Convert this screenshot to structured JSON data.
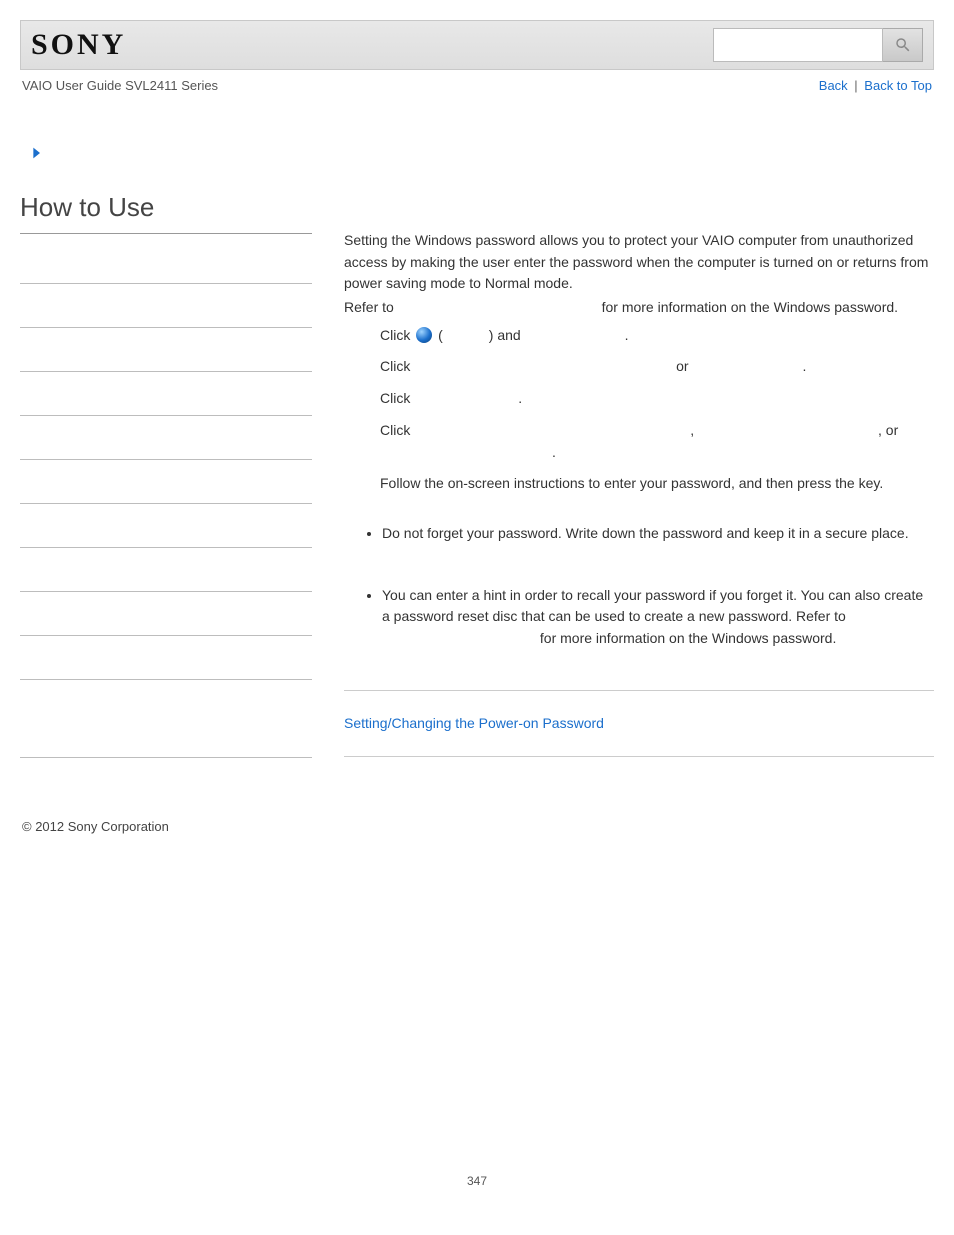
{
  "header": {
    "logo_text": "SONY",
    "search_placeholder": ""
  },
  "subheader": {
    "guide_title": "VAIO User Guide SVL2411 Series",
    "nav": {
      "back": "Back",
      "top": "Back to Top",
      "sep": " | "
    }
  },
  "sidebar": {
    "heading": "How to Use"
  },
  "main": {
    "intro1": "Setting the Windows password allows you to protect your VAIO computer from unauthorized access by making the user enter the password when the computer is turned on or returns from power saving mode to Normal mode.",
    "intro2a": "Refer to ",
    "intro2b": " for more information on the Windows password.",
    "steps": {
      "s1a": "Click ",
      "s1b": " (",
      "s1c": ") and ",
      "s1d": ".",
      "s2a": "Click ",
      "s2b": " or ",
      "s2c": ".",
      "s3a": "Click ",
      "s3b": ".",
      "s4a": "Click ",
      "s4b": ", ",
      "s4c": ", or",
      "s4d": "."
    },
    "follow": "Follow the on-screen instructions to enter your password, and then press the key.",
    "notes": {
      "n1": "Do not forget your password. Write down the password and keep it in a secure place.",
      "n2a": "You can enter a hint in order to recall your password if you forget it. You can also create a password reset disc that can be used to create a new password. Refer to ",
      "n2b": " for more information on the Windows password."
    },
    "related_link": "Setting/Changing the Power-on Password"
  },
  "footer": {
    "copyright": "© 2012 Sony Corporation"
  },
  "page_number": "347"
}
